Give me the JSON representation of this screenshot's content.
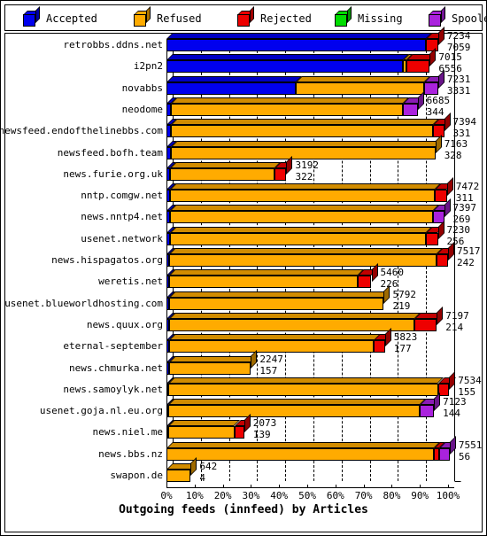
{
  "legend": {
    "items": [
      {
        "label": "Accepted",
        "color": "#0000ee",
        "icon": "cube-icon"
      },
      {
        "label": "Refused",
        "color": "#ffab00",
        "icon": "cube-icon"
      },
      {
        "label": "Rejected",
        "color": "#ee0000",
        "icon": "cube-icon"
      },
      {
        "label": "Missing",
        "color": "#00dd00",
        "icon": "cube-icon"
      },
      {
        "label": "Spooled",
        "color": "#aa22dd",
        "icon": "cube-icon"
      }
    ]
  },
  "chart_data": {
    "type": "bar",
    "orientation": "horizontal",
    "stacked": true,
    "percent_axis": true,
    "title": "Outgoing feeds (innfeed) by Articles",
    "xlabel": "Outgoing feeds (innfeed) by Articles",
    "ylabel": "",
    "xlim": [
      0,
      100
    ],
    "grid": true,
    "legend_position": "top",
    "xticks": [
      "0%",
      "10%",
      "20%",
      "30%",
      "40%",
      "50%",
      "60%",
      "70%",
      "80%",
      "90%",
      "100%"
    ],
    "xtick_values": [
      0,
      10,
      20,
      30,
      40,
      50,
      60,
      70,
      80,
      90,
      100
    ],
    "series": [
      {
        "name": "Accepted",
        "color": "#0000ee"
      },
      {
        "name": "Refused",
        "color": "#ffab00"
      },
      {
        "name": "Rejected",
        "color": "#ee0000"
      },
      {
        "name": "Missing",
        "color": "#00dd00"
      },
      {
        "name": "Spooled",
        "color": "#aa22dd"
      }
    ],
    "categories": [
      "retrobbs.ddns.net",
      "i2pn2",
      "novabbs",
      "neodome",
      "newsfeed.endofthelinebbs.com",
      "newsfeed.bofh.team",
      "news.furie.org.uk",
      "nntp.comgw.net",
      "news.nntp4.net",
      "usenet.network",
      "news.hispagatos.org",
      "weretis.net",
      "usenet.blueworldhosting.com",
      "news.quux.org",
      "eternal-september",
      "news.chmurka.net",
      "news.samoylyk.net",
      "usenet.goja.nl.eu.org",
      "news.niel.me",
      "news.bbs.nz",
      "swapon.de"
    ],
    "rows": [
      {
        "label": "retrobbs.ddns.net",
        "total": 7234,
        "secondary": 7059,
        "bar_pct": 96.5,
        "segments": [
          {
            "series": "Accepted",
            "pct": 92.0
          },
          {
            "series": "Rejected",
            "pct": 4.5
          }
        ]
      },
      {
        "label": "i2pn2",
        "total": 7015,
        "secondary": 6556,
        "bar_pct": 93.5,
        "segments": [
          {
            "series": "Accepted",
            "pct": 84.0
          },
          {
            "series": "Refused",
            "pct": 1.2
          },
          {
            "series": "Rejected",
            "pct": 8.3
          }
        ]
      },
      {
        "label": "novabbs",
        "total": 7231,
        "secondary": 3331,
        "bar_pct": 96.5,
        "segments": [
          {
            "series": "Accepted",
            "pct": 46.0
          },
          {
            "series": "Refused",
            "pct": 45.5
          },
          {
            "series": "Spooled",
            "pct": 5.0
          }
        ]
      },
      {
        "label": "neodome",
        "total": 6685,
        "secondary": 344,
        "bar_pct": 89.2,
        "segments": [
          {
            "series": "Accepted",
            "pct": 1.6
          },
          {
            "series": "Refused",
            "pct": 82.4
          },
          {
            "series": "Spooled",
            "pct": 5.2
          }
        ]
      },
      {
        "label": "newsfeed.endofthelinebbs.com",
        "total": 7394,
        "secondary": 331,
        "bar_pct": 98.6,
        "segments": [
          {
            "series": "Accepted",
            "pct": 1.5
          },
          {
            "series": "Refused",
            "pct": 93.1
          },
          {
            "series": "Rejected",
            "pct": 4.0
          }
        ]
      },
      {
        "label": "newsfeed.bofh.team",
        "total": 7163,
        "secondary": 328,
        "bar_pct": 95.5,
        "segments": [
          {
            "series": "Accepted",
            "pct": 1.5
          },
          {
            "series": "Refused",
            "pct": 94.0
          }
        ]
      },
      {
        "label": "news.furie.org.uk",
        "total": 3192,
        "secondary": 322,
        "bar_pct": 42.6,
        "segments": [
          {
            "series": "Accepted",
            "pct": 1.4
          },
          {
            "series": "Refused",
            "pct": 37.0
          },
          {
            "series": "Rejected",
            "pct": 4.2
          }
        ]
      },
      {
        "label": "nntp.comgw.net",
        "total": 7472,
        "secondary": 311,
        "bar_pct": 99.6,
        "segments": [
          {
            "series": "Accepted",
            "pct": 1.4
          },
          {
            "series": "Refused",
            "pct": 94.0
          },
          {
            "series": "Rejected",
            "pct": 4.2
          }
        ]
      },
      {
        "label": "news.nntp4.net",
        "total": 7397,
        "secondary": 269,
        "bar_pct": 98.6,
        "segments": [
          {
            "series": "Accepted",
            "pct": 1.2
          },
          {
            "series": "Refused",
            "pct": 93.4
          },
          {
            "series": "Spooled",
            "pct": 4.0
          }
        ]
      },
      {
        "label": "usenet.network",
        "total": 7230,
        "secondary": 256,
        "bar_pct": 96.4,
        "segments": [
          {
            "series": "Accepted",
            "pct": 1.2
          },
          {
            "series": "Refused",
            "pct": 91.0
          },
          {
            "series": "Rejected",
            "pct": 4.2
          }
        ]
      },
      {
        "label": "news.hispagatos.org",
        "total": 7517,
        "secondary": 242,
        "bar_pct": 100.0,
        "segments": [
          {
            "series": "Accepted",
            "pct": 1.1
          },
          {
            "series": "Refused",
            "pct": 94.9
          },
          {
            "series": "Rejected",
            "pct": 4.0
          }
        ]
      },
      {
        "label": "weretis.net",
        "total": 5460,
        "secondary": 226,
        "bar_pct": 72.8,
        "segments": [
          {
            "series": "Accepted",
            "pct": 1.0
          },
          {
            "series": "Refused",
            "pct": 67.0
          },
          {
            "series": "Rejected",
            "pct": 4.8
          }
        ]
      },
      {
        "label": "usenet.blueworldhosting.com",
        "total": 5792,
        "secondary": 219,
        "bar_pct": 77.2,
        "segments": [
          {
            "series": "Accepted",
            "pct": 1.0
          },
          {
            "series": "Refused",
            "pct": 76.2
          }
        ]
      },
      {
        "label": "news.quux.org",
        "total": 7197,
        "secondary": 214,
        "bar_pct": 96.0,
        "segments": [
          {
            "series": "Accepted",
            "pct": 1.0
          },
          {
            "series": "Refused",
            "pct": 87.0
          },
          {
            "series": "Rejected",
            "pct": 8.0
          }
        ]
      },
      {
        "label": "eternal-september",
        "total": 5823,
        "secondary": 177,
        "bar_pct": 77.6,
        "segments": [
          {
            "series": "Accepted",
            "pct": 0.8
          },
          {
            "series": "Refused",
            "pct": 72.8
          },
          {
            "series": "Rejected",
            "pct": 4.0
          }
        ]
      },
      {
        "label": "news.chmurka.net",
        "total": 2247,
        "secondary": 157,
        "bar_pct": 30.0,
        "segments": [
          {
            "series": "Accepted",
            "pct": 0.8
          },
          {
            "series": "Refused",
            "pct": 29.2
          }
        ]
      },
      {
        "label": "news.samoylyk.net",
        "total": 7534,
        "secondary": 155,
        "bar_pct": 100.4,
        "segments": [
          {
            "series": "Accepted",
            "pct": 0.7
          },
          {
            "series": "Refused",
            "pct": 95.7
          },
          {
            "series": "Rejected",
            "pct": 4.0
          }
        ]
      },
      {
        "label": "usenet.goja.nl.eu.org",
        "total": 7123,
        "secondary": 144,
        "bar_pct": 95.0,
        "segments": [
          {
            "series": "Accepted",
            "pct": 0.7
          },
          {
            "series": "Refused",
            "pct": 89.3
          },
          {
            "series": "Spooled",
            "pct": 5.0
          }
        ]
      },
      {
        "label": "news.niel.me",
        "total": 2073,
        "secondary": 139,
        "bar_pct": 27.6,
        "segments": [
          {
            "series": "Accepted",
            "pct": 0.7
          },
          {
            "series": "Refused",
            "pct": 23.4
          },
          {
            "series": "Rejected",
            "pct": 3.5
          }
        ]
      },
      {
        "label": "news.bbs.nz",
        "total": 7551,
        "secondary": 56,
        "bar_pct": 100.6,
        "segments": [
          {
            "series": "Refused",
            "pct": 95.0
          },
          {
            "series": "Rejected",
            "pct": 1.8
          },
          {
            "series": "Spooled",
            "pct": 3.8
          }
        ]
      },
      {
        "label": "swapon.de",
        "total": 642,
        "secondary": 4,
        "bar_pct": 8.6,
        "segments": [
          {
            "series": "Refused",
            "pct": 8.6
          }
        ]
      }
    ]
  }
}
